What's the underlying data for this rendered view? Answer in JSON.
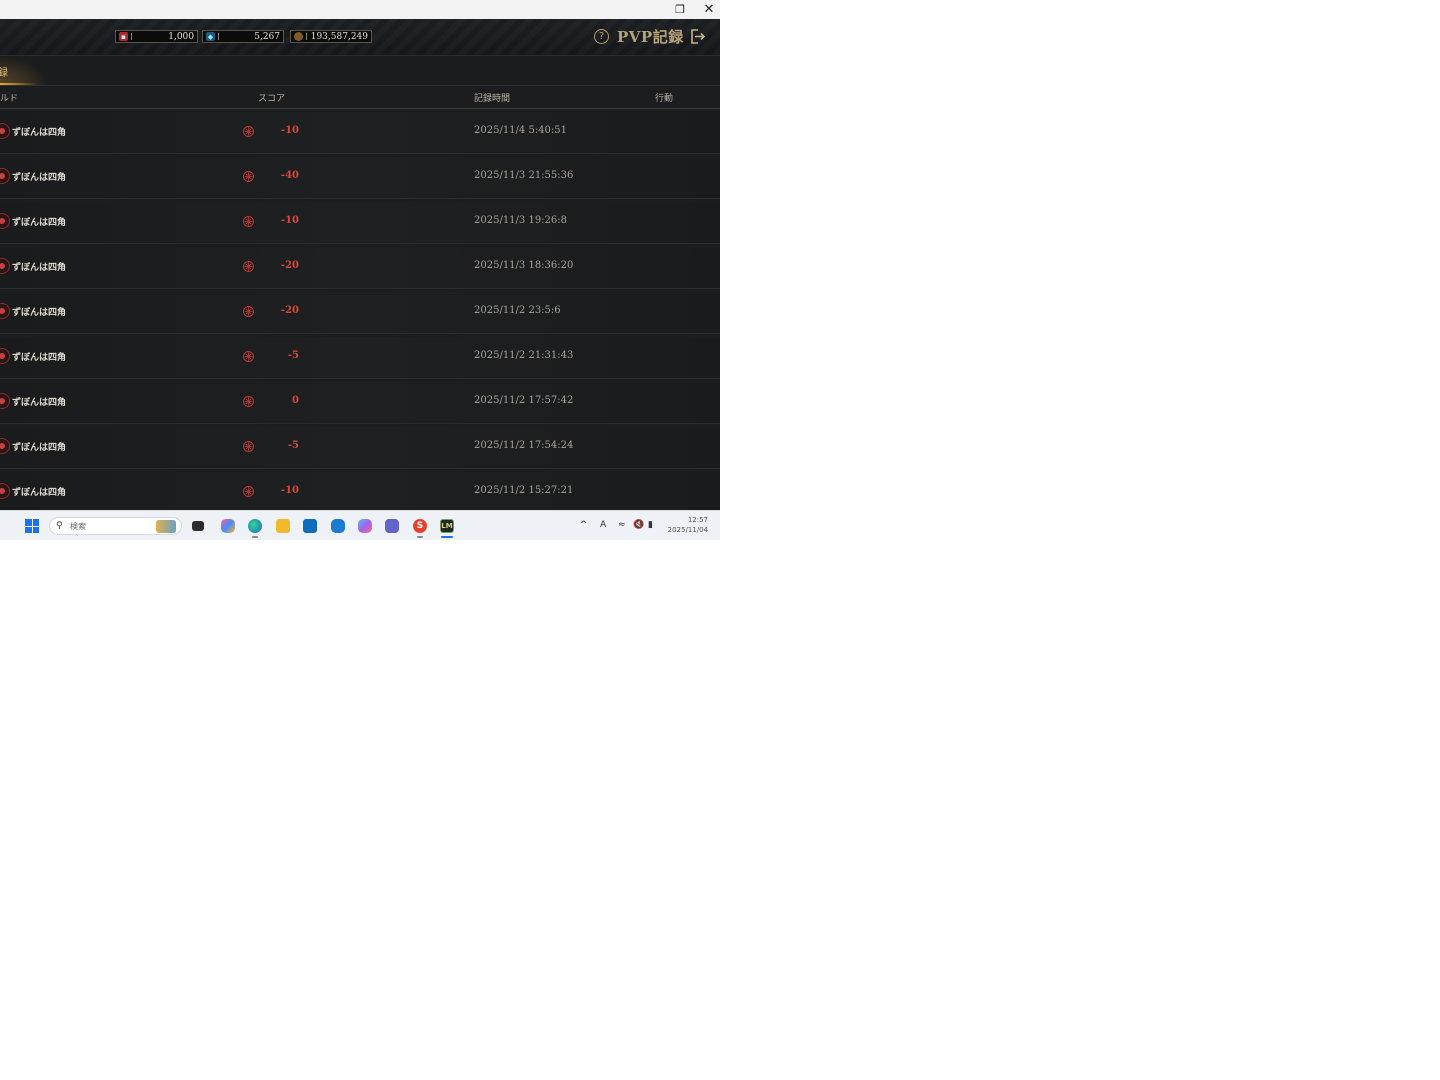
{
  "window": {
    "restore_glyph": "❐",
    "close_glyph": "✕"
  },
  "resources": [
    {
      "icon": "ruby-ticket-icon",
      "value": "1,000",
      "color": "#b3282d"
    },
    {
      "icon": "diamond-icon",
      "value": "5,267",
      "color": "#1e5a7a"
    },
    {
      "icon": "gold-coin-icon",
      "value": "193,587,249",
      "color": "#7c5b2c"
    }
  ],
  "header": {
    "help_glyph": "?",
    "title": "PVP記録"
  },
  "tabs": {
    "active_label": "録"
  },
  "table": {
    "headers": {
      "guild": "ルド",
      "score": "スコア",
      "time": "記録時間",
      "action": "行動"
    },
    "rows": [
      {
        "guild": "ずぼんは四角",
        "score": "-10",
        "time": "2025/11/4 5:40:51"
      },
      {
        "guild": "ずぼんは四角",
        "score": "-40",
        "time": "2025/11/3 21:55:36"
      },
      {
        "guild": "ずぼんは四角",
        "score": "-10",
        "time": "2025/11/3 19:26:8"
      },
      {
        "guild": "ずぼんは四角",
        "score": "-20",
        "time": "2025/11/3 18:36:20"
      },
      {
        "guild": "ずぼんは四角",
        "score": "-20",
        "time": "2025/11/2 23:5:6"
      },
      {
        "guild": "ずぼんは四角",
        "score": "-5",
        "time": "2025/11/2 21:31:43"
      },
      {
        "guild": "ずぼんは四角",
        "score": "0",
        "time": "2025/11/2 17:57:42"
      },
      {
        "guild": "ずぼんは四角",
        "score": "-5",
        "time": "2025/11/2 17:54:24"
      },
      {
        "guild": "ずぼんは四角",
        "score": "-10",
        "time": "2025/11/2 15:27:21"
      }
    ]
  },
  "taskbar": {
    "search_placeholder": "検索",
    "game_label": "LM",
    "s_label": "S",
    "tray": {
      "chevron": "^",
      "ime": "A"
    },
    "clock": {
      "time": "12:57",
      "date": "2025/11/04"
    }
  },
  "colors": {
    "score_negative": "#d9483a",
    "accent_gold": "#e3a838",
    "title_gold": "#b7a27a"
  }
}
